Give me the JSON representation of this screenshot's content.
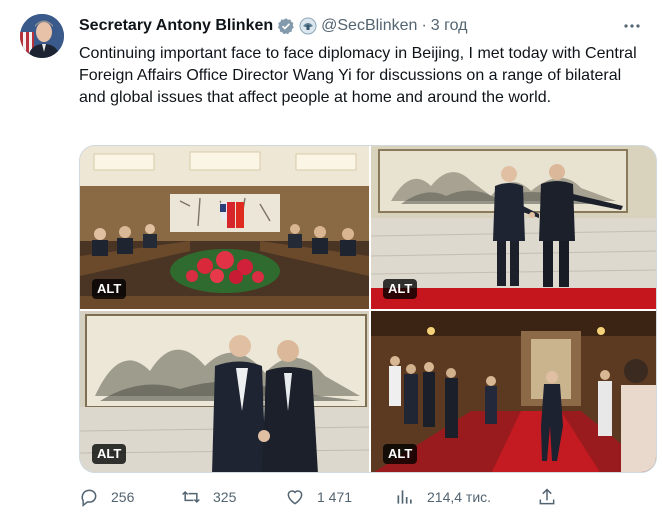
{
  "author": {
    "name": "Secretary Antony Blinken",
    "handle": "@SecBlinken",
    "separator": "·",
    "time": "3 год"
  },
  "tweet": {
    "text": "Continuing important face to face diplomacy in Beijing, I met today with Central Foreign Affairs Office Director Wang Yi for discussions on a range of bilateral and global issues that affect people at home and around the world."
  },
  "media": [
    {
      "alt_label": "ALT"
    },
    {
      "alt_label": "ALT"
    },
    {
      "alt_label": "ALT"
    },
    {
      "alt_label": "ALT"
    }
  ],
  "actions": {
    "replies": "256",
    "reposts": "325",
    "likes": "1 471",
    "views": "214,4 тис."
  },
  "colors": {
    "text": "#0f1419",
    "secondary": "#536471",
    "verified": "#829aab",
    "carpet": "#c4161c"
  }
}
